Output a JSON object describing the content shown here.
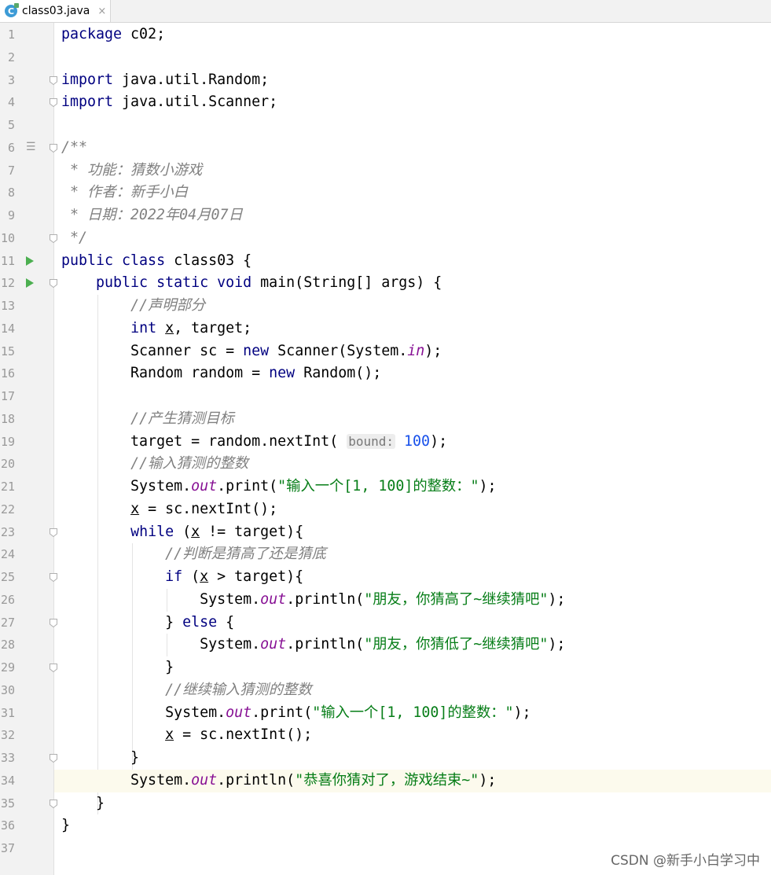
{
  "tab": {
    "title": "class03.java",
    "close": "×",
    "icon": "C"
  },
  "lines": [
    {
      "n": "1",
      "html": "<span class='kw'>package</span> c02;"
    },
    {
      "n": "2",
      "html": ""
    },
    {
      "n": "3",
      "html": "<span class='kw'>import</span> java.util.Random;"
    },
    {
      "n": "4",
      "html": "<span class='kw'>import</span> java.util.Scanner;"
    },
    {
      "n": "5",
      "html": ""
    },
    {
      "n": "6",
      "html": "<span class='cm'>/**</span>"
    },
    {
      "n": "7",
      "html": "<span class='cm'> * 功能：猜数小游戏</span>"
    },
    {
      "n": "8",
      "html": "<span class='cm'> * 作者：新手小白</span>"
    },
    {
      "n": "9",
      "html": "<span class='cm'> * 日期：2022年04月07日</span>"
    },
    {
      "n": "10",
      "html": "<span class='cm'> */</span>"
    },
    {
      "n": "11",
      "html": "<span class='kw'>public class</span> class03 {"
    },
    {
      "n": "12",
      "html": "    <span class='kw'>public static void</span> main(String[] args) {"
    },
    {
      "n": "13",
      "html": "        <span class='cm'>//声明部分</span>"
    },
    {
      "n": "14",
      "html": "        <span class='kw'>int</span> <span class='ul'>x</span>, target;"
    },
    {
      "n": "15",
      "html": "        Scanner sc = <span class='kw'>new</span> Scanner(System.<span class='fld'>in</span>);"
    },
    {
      "n": "16",
      "html": "        Random random = <span class='kw'>new</span> Random();"
    },
    {
      "n": "17",
      "html": ""
    },
    {
      "n": "18",
      "html": "        <span class='cm'>//产生猜测目标</span>"
    },
    {
      "n": "19",
      "html": "        target = random.nextInt( <span class='hint'>bound:</span> <span class='num'>100</span>);"
    },
    {
      "n": "20",
      "html": "        <span class='cm'>//输入猜测的整数</span>"
    },
    {
      "n": "21",
      "html": "        System.<span class='fld'>out</span>.print(<span class='str'>\"输入一个[1, 100]的整数：\"</span>);"
    },
    {
      "n": "22",
      "html": "        <span class='ul'>x</span> = sc.nextInt();"
    },
    {
      "n": "23",
      "html": "        <span class='kw'>while</span> (<span class='ul'>x</span> != target){"
    },
    {
      "n": "24",
      "html": "            <span class='cm'>//判断是猜高了还是猜底</span>"
    },
    {
      "n": "25",
      "html": "            <span class='kw'>if</span> (<span class='ul'>x</span> &gt; target){"
    },
    {
      "n": "26",
      "html": "                System.<span class='fld'>out</span>.println(<span class='str'>\"朋友，你猜高了~继续猜吧\"</span>);"
    },
    {
      "n": "27",
      "html": "            } <span class='kw'>else</span> {"
    },
    {
      "n": "28",
      "html": "                System.<span class='fld'>out</span>.println(<span class='str'>\"朋友，你猜低了~继续猜吧\"</span>);"
    },
    {
      "n": "29",
      "html": "            }"
    },
    {
      "n": "30",
      "html": "            <span class='cm'>//继续输入猜测的整数</span>"
    },
    {
      "n": "31",
      "html": "            System.<span class='fld'>out</span>.print(<span class='str'>\"输入一个[1, 100]的整数：\"</span>);"
    },
    {
      "n": "32",
      "html": "            <span class='ul'>x</span> = sc.nextInt();"
    },
    {
      "n": "33",
      "html": "        }"
    },
    {
      "n": "34",
      "html": "        System.<span class='fld'>out</span>.println(<span class='str'>\"恭喜你猜对了，游戏结束~\"</span>);"
    },
    {
      "n": "35",
      "html": "    }"
    },
    {
      "n": "36",
      "html": "}"
    },
    {
      "n": "37",
      "html": ""
    }
  ],
  "highlight_line": 34,
  "run_lines": [
    11,
    12
  ],
  "doc_icon_line": 6,
  "fold_lines": [
    3,
    4,
    6,
    10,
    12,
    23,
    25,
    27,
    29,
    33,
    35
  ],
  "watermark": "CSDN @新手小白学习中"
}
